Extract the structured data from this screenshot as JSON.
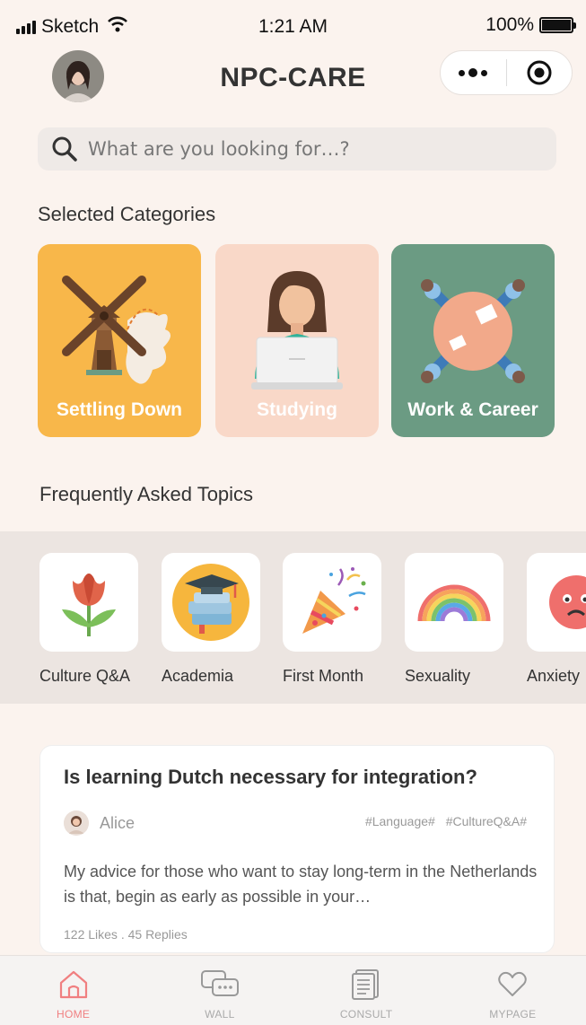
{
  "status_bar": {
    "carrier": "Sketch",
    "time": "1:21 AM",
    "battery": "100%"
  },
  "header": {
    "title": "NPC-CARE"
  },
  "search": {
    "placeholder": "What are you looking for…?"
  },
  "categories": {
    "title": "Selected Categories",
    "items": [
      {
        "label": "Settling Down",
        "color": "#f8b74a"
      },
      {
        "label": "Studying",
        "color": "#f9d8c8"
      },
      {
        "label": "Work & Career",
        "color": "#6b9b83"
      }
    ]
  },
  "faq": {
    "title": "Frequently Asked Topics",
    "topics": [
      {
        "label": "Culture Q&A",
        "icon": "tulip-icon"
      },
      {
        "label": "Academia",
        "icon": "graduation-icon"
      },
      {
        "label": "First Month",
        "icon": "party-popper-icon"
      },
      {
        "label": "Sexuality",
        "icon": "rainbow-icon"
      },
      {
        "label": "Anxiety",
        "icon": "anxious-face-icon"
      }
    ]
  },
  "post": {
    "title": "Is learning Dutch necessary for integration?",
    "author": "Alice",
    "tags": [
      "#Language#",
      "#CultureQ&A#"
    ],
    "excerpt": "My advice for those who want to stay long-term in the Netherlands is that, begin as early as possible in your…",
    "likes": "122 Likes .",
    "replies": "45 Replies"
  },
  "tabbar": {
    "items": [
      {
        "label": "HOME",
        "icon": "home-icon",
        "active": true
      },
      {
        "label": "WALL",
        "icon": "chat-icon",
        "active": false
      },
      {
        "label": "CONSULT",
        "icon": "document-icon",
        "active": false
      },
      {
        "label": "MYPAGE",
        "icon": "heart-icon",
        "active": false
      }
    ]
  },
  "colors": {
    "accent": "#f07f80",
    "background": "#fbf3ee"
  }
}
